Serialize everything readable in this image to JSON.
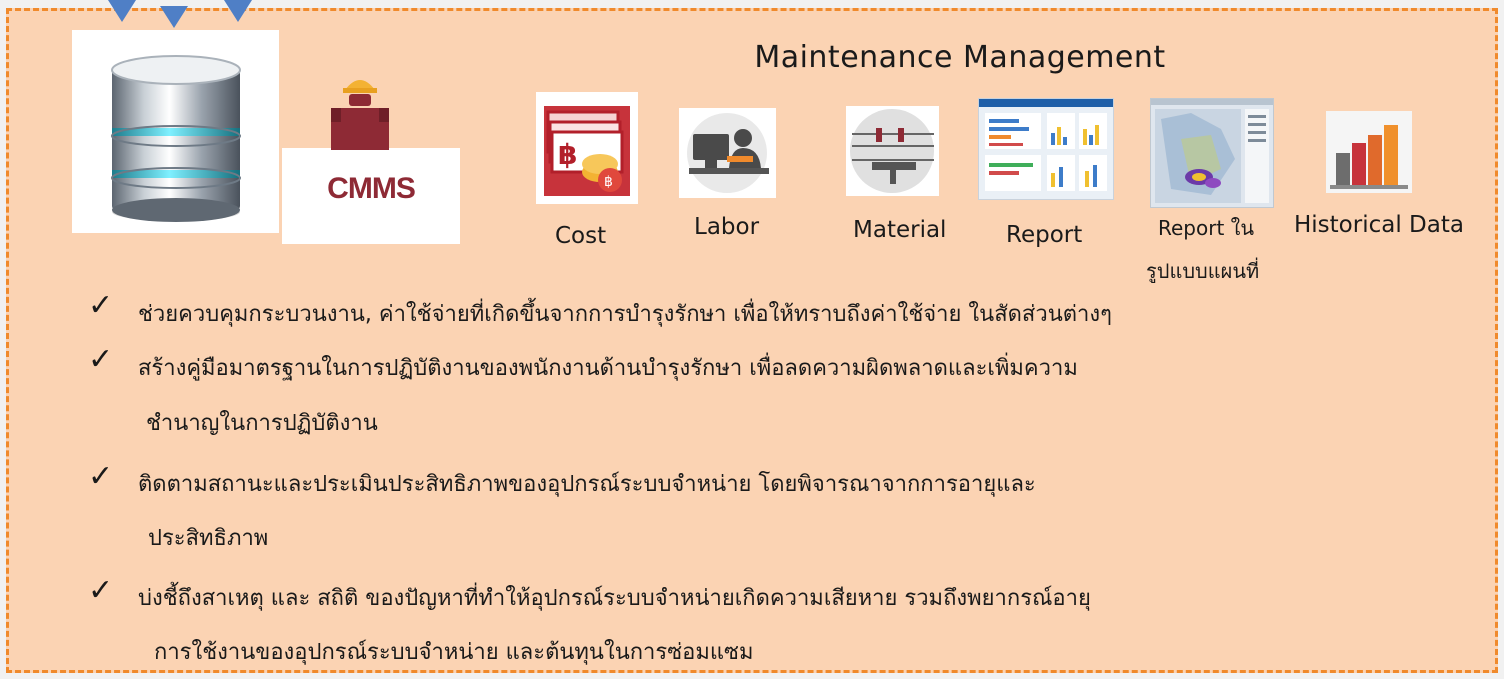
{
  "colors": {
    "background": "#f1f1f1",
    "panel": "#fbd3b3",
    "border": "#f08a2c",
    "arrow": "#4f7fc6",
    "cmms_brand": "#8e2a35"
  },
  "header": {
    "title": "Maintenance Management"
  },
  "logo": {
    "text": "CMMS",
    "icon": "worker-reading-icon"
  },
  "database": {
    "icon": "database-icon"
  },
  "modules": [
    {
      "label": "Cost",
      "icon": "baht-coins-icon"
    },
    {
      "label": "Labor",
      "icon": "computer-worker-icon"
    },
    {
      "label": "Material",
      "icon": "power-line-icon"
    },
    {
      "label": "Report",
      "icon": "report-dashboard-icon"
    },
    {
      "label": "Report ใน",
      "label2": "รูปแบบแผนที่",
      "icon": "heat-map-icon"
    },
    {
      "label": "Historical Data",
      "icon": "bar-chart-icon"
    }
  ],
  "bullets": [
    {
      "lines": [
        "ช่วยควบคุมกระบวนงาน, ค่าใช้จ่ายที่เกิดขึ้นจากการบำรุงรักษา เพื่อให้ทราบถึงค่าใช้จ่าย ในสัดส่วนต่างๆ"
      ]
    },
    {
      "lines": [
        "สร้างคู่มือมาตรฐานในการปฏิบัติงานของพนักงานด้านบำรุงรักษา เพื่อลดความผิดพลาดและเพิ่มความ",
        "ชำนาญในการปฏิบัติงาน"
      ]
    },
    {
      "lines": [
        "ติดตามสถานะและประเมินประสิทธิภาพของอุปกรณ์ระบบจำหน่าย โดยพิจารณาจากการอายุและ",
        "ประสิทธิภาพ"
      ]
    },
    {
      "lines": [
        "บ่งชี้ถึงสาเหตุ และ สถิติ ของปัญหาที่ทำให้อุปกรณ์ระบบจำหน่ายเกิดความเสียหาย รวมถึงพยากรณ์อายุ",
        "การใช้งานของอุปกรณ์ระบบจำหน่าย และต้นทุนในการซ่อมแซม"
      ]
    }
  ],
  "check_symbol": "✓"
}
